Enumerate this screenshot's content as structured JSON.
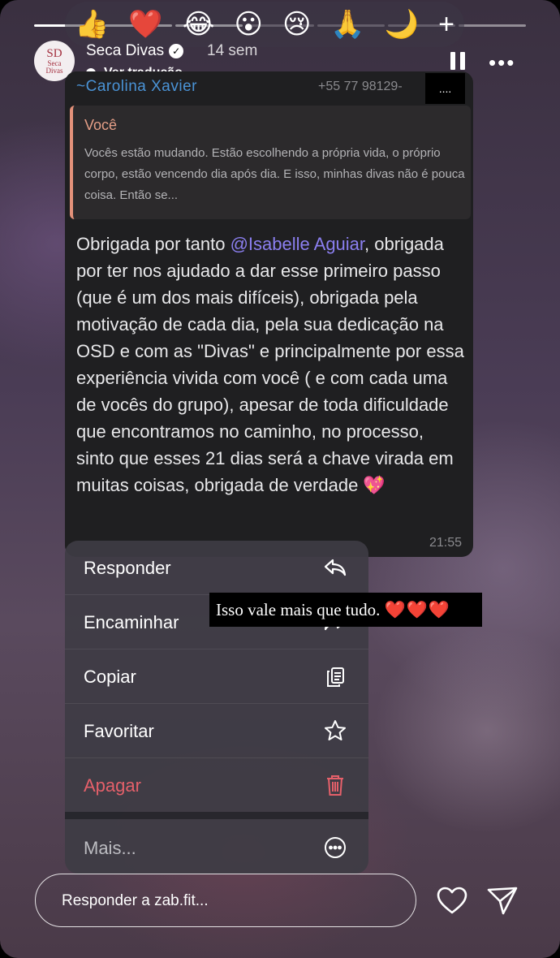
{
  "reactions": [
    "👍",
    "❤️",
    "😂",
    "😮",
    "😢",
    "🙏",
    "🌙",
    "+"
  ],
  "header": {
    "avatar_mono": "SD",
    "avatar_line1": "Seca",
    "avatar_line2": "Divas",
    "username": "Seca Divas",
    "time": "14 sem",
    "translate": "Ver tradução"
  },
  "message": {
    "sender": "~Carolina Xavier",
    "phone": "+55 77 98129-",
    "phone_mask": "....",
    "quote_name": "Você",
    "quote_text": "Vocês estão mudando. Estão escolhendo a própria vida, o próprio corpo, estão vencendo dia após dia. E isso, minhas divas não é pouca coisa. Então se...",
    "body_pre": "Obrigada por tanto ",
    "mention": "@Isabelle Aguiar",
    "body_post": ", obrigada por ter nos ajudado a dar esse primeiro passo (que é um dos mais difíceis), obrigada pela motivação de cada dia, pela sua dedicação na OSD e com as \"Divas\" e principalmente por essa experiência vivida com você ( e com cada uma de vocês do grupo), apesar de toda dificuldade que encontramos no caminho, no processo, sinto que esses 21 dias será a chave virada em muitas coisas, obrigada de verdade 💖",
    "timestamp": "21:55"
  },
  "menu": {
    "reply": "Responder",
    "forward": "Encaminhar",
    "copy": "Copiar",
    "favorite": "Favoritar",
    "delete": "Apagar",
    "more": "Mais..."
  },
  "overlay": {
    "text": "Isso vale mais que tudo. ",
    "hearts": "❤️❤️❤️"
  },
  "reply": {
    "placeholder": "Responder a zab.fit..."
  },
  "colors": {
    "accent_blue": "#4a93d6",
    "mention_purple": "#8b7ff0",
    "quote_orange": "#e59f87",
    "danger_red": "#e5606a"
  }
}
